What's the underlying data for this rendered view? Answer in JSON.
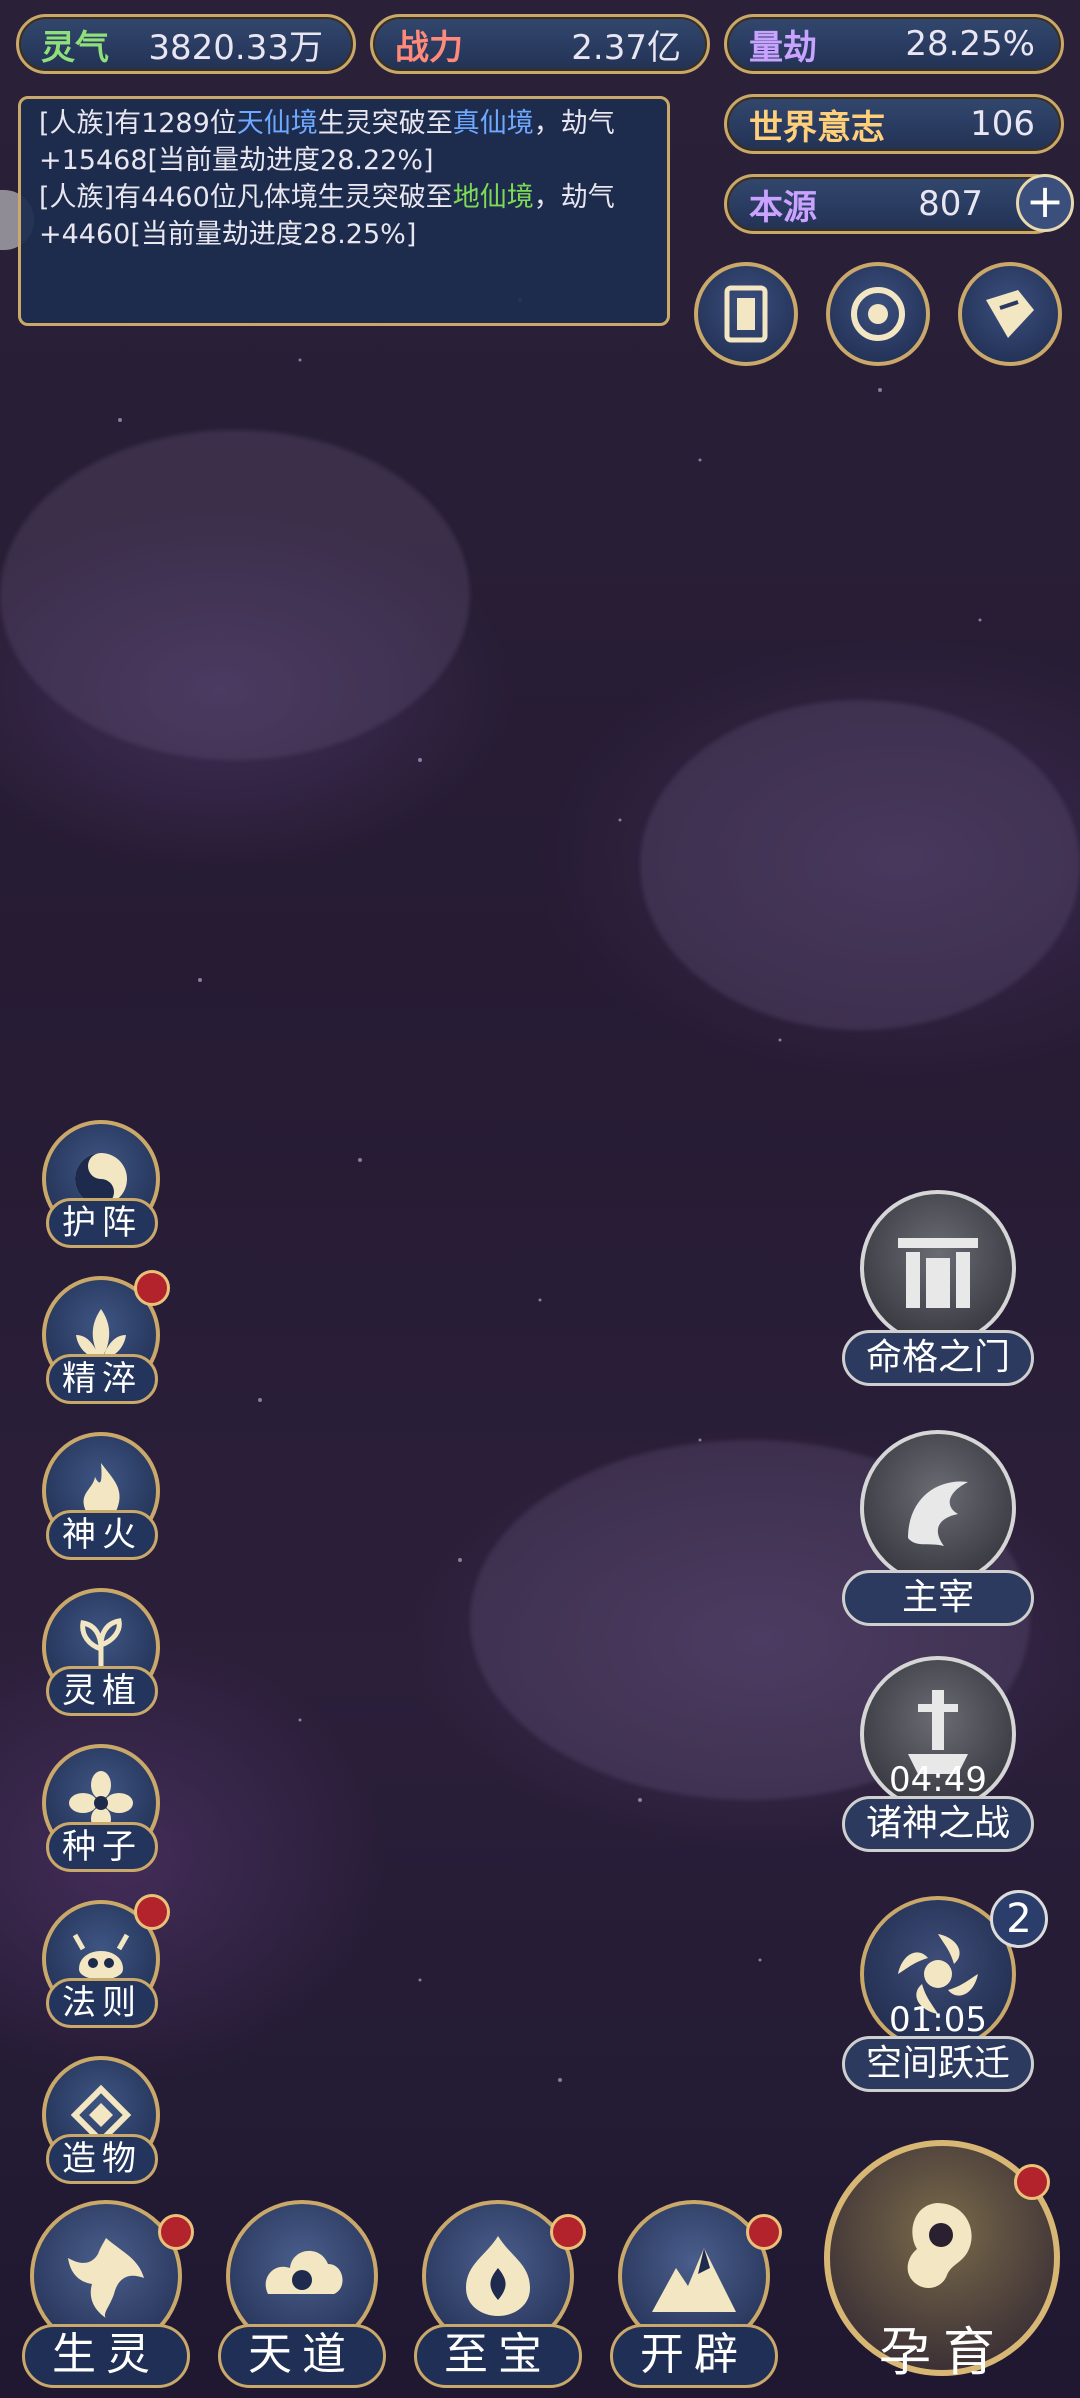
{
  "stats": {
    "lingqi": {
      "label": "灵气",
      "value": "3820.33万"
    },
    "zhanli": {
      "label": "战力",
      "value": "2.37亿"
    },
    "liangjie": {
      "label": "量劫",
      "value": "28.25%"
    },
    "shijie": {
      "label": "世界意志",
      "value": "106"
    },
    "benyuan": {
      "label": "本源",
      "value": "807",
      "plus": "+"
    }
  },
  "log": {
    "line1": {
      "p1": "[人族]有1289位",
      "h1": "天仙境",
      "p2": "生灵突破至",
      "h2": "真仙境",
      "p3": "，劫气+15468[当前量劫进度28.22%]"
    },
    "line2": {
      "p1": "[人族]有4460位凡体境生灵突破至",
      "h1": "地仙境",
      "p2": "，劫气+4460[当前量劫进度28.25%]"
    }
  },
  "left_menu": [
    {
      "label": "护阵",
      "icon": "taiji-icon",
      "dot": false
    },
    {
      "label": "精淬",
      "icon": "lotus-flame-icon",
      "dot": true
    },
    {
      "label": "神火",
      "icon": "fire-icon",
      "dot": false
    },
    {
      "label": "灵植",
      "icon": "plant-icon",
      "dot": false
    },
    {
      "label": "种子",
      "icon": "flower-icon",
      "dot": false
    },
    {
      "label": "法则",
      "icon": "beast-icon",
      "dot": true
    },
    {
      "label": "造物",
      "icon": "diamond-icon",
      "dot": false
    }
  ],
  "right_menu": [
    {
      "label": "命格之门",
      "icon": "gate-icon"
    },
    {
      "label": "主宰",
      "icon": "dragon-icon"
    },
    {
      "label": "诸神之战",
      "icon": "sword-icon",
      "timer": "04:49"
    },
    {
      "label": "空间跃迁",
      "icon": "vortex-icon",
      "timer": "01:05",
      "badge": "2"
    }
  ],
  "bottom": [
    {
      "label": "生灵",
      "icon": "phoenix-icon",
      "dot": true
    },
    {
      "label": "天道",
      "icon": "cloud-icon",
      "dot": false
    },
    {
      "label": "至宝",
      "icon": "treasure-icon",
      "dot": true
    },
    {
      "label": "开辟",
      "icon": "mountain-icon",
      "dot": true
    }
  ],
  "main_action": {
    "label": "孕育",
    "icon": "embryo-icon",
    "dot": true
  },
  "top_icons": [
    "card-icon",
    "portal-icon",
    "scroll-icon"
  ]
}
